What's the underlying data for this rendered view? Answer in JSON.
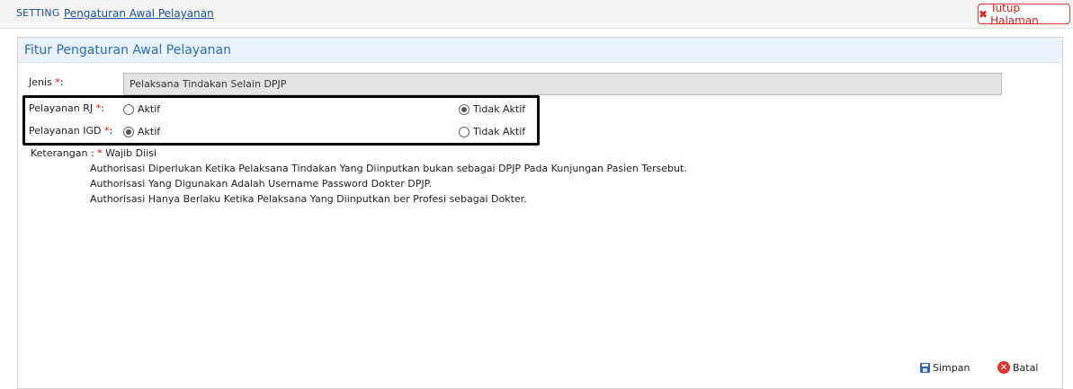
{
  "header": {
    "section": "SETTING",
    "breadcrumb_link": "Pengaturan Awal Pelayanan",
    "close_label": "Tutup Halaman"
  },
  "panel": {
    "title": "Fitur Pengaturan Awal Pelayanan"
  },
  "form": {
    "jenis_label": "Jenis",
    "jenis_value": "Pelaksana Tindakan Selain DPJP",
    "rj_label": "Pelayanan RJ",
    "igd_label": "Pelayanan IGD",
    "required_mark": "*",
    "colon": ":",
    "option_active": "Aktif",
    "option_inactive": "Tidak Aktif",
    "rj_selected": "Tidak Aktif",
    "igd_selected": "Aktif"
  },
  "keterangan": {
    "label": "Keterangan :",
    "required_mark": "*",
    "required_text": "Wajib Diisi",
    "lines": [
      "Authorisasi Diperlukan Ketika Pelaksana Tindakan Yang Diinputkan bukan sebagai DPJP Pada Kunjungan Pasien Tersebut.",
      "Authorisasi Yang Digunakan Adalah Username Password Dokter DPJP.",
      "Authorisasi Hanya Berlaku Ketika Pelaksana Yang Diinputkan ber Profesi sebagai Dokter."
    ]
  },
  "actions": {
    "save_label": "Simpan",
    "cancel_label": "Batal"
  },
  "icons": {
    "close": "close-icon",
    "save": "save-icon",
    "cancel": "cancel-icon"
  },
  "colors": {
    "link": "#1a4fa0",
    "panel_title": "#2c6cb6",
    "danger": "#d42020"
  }
}
